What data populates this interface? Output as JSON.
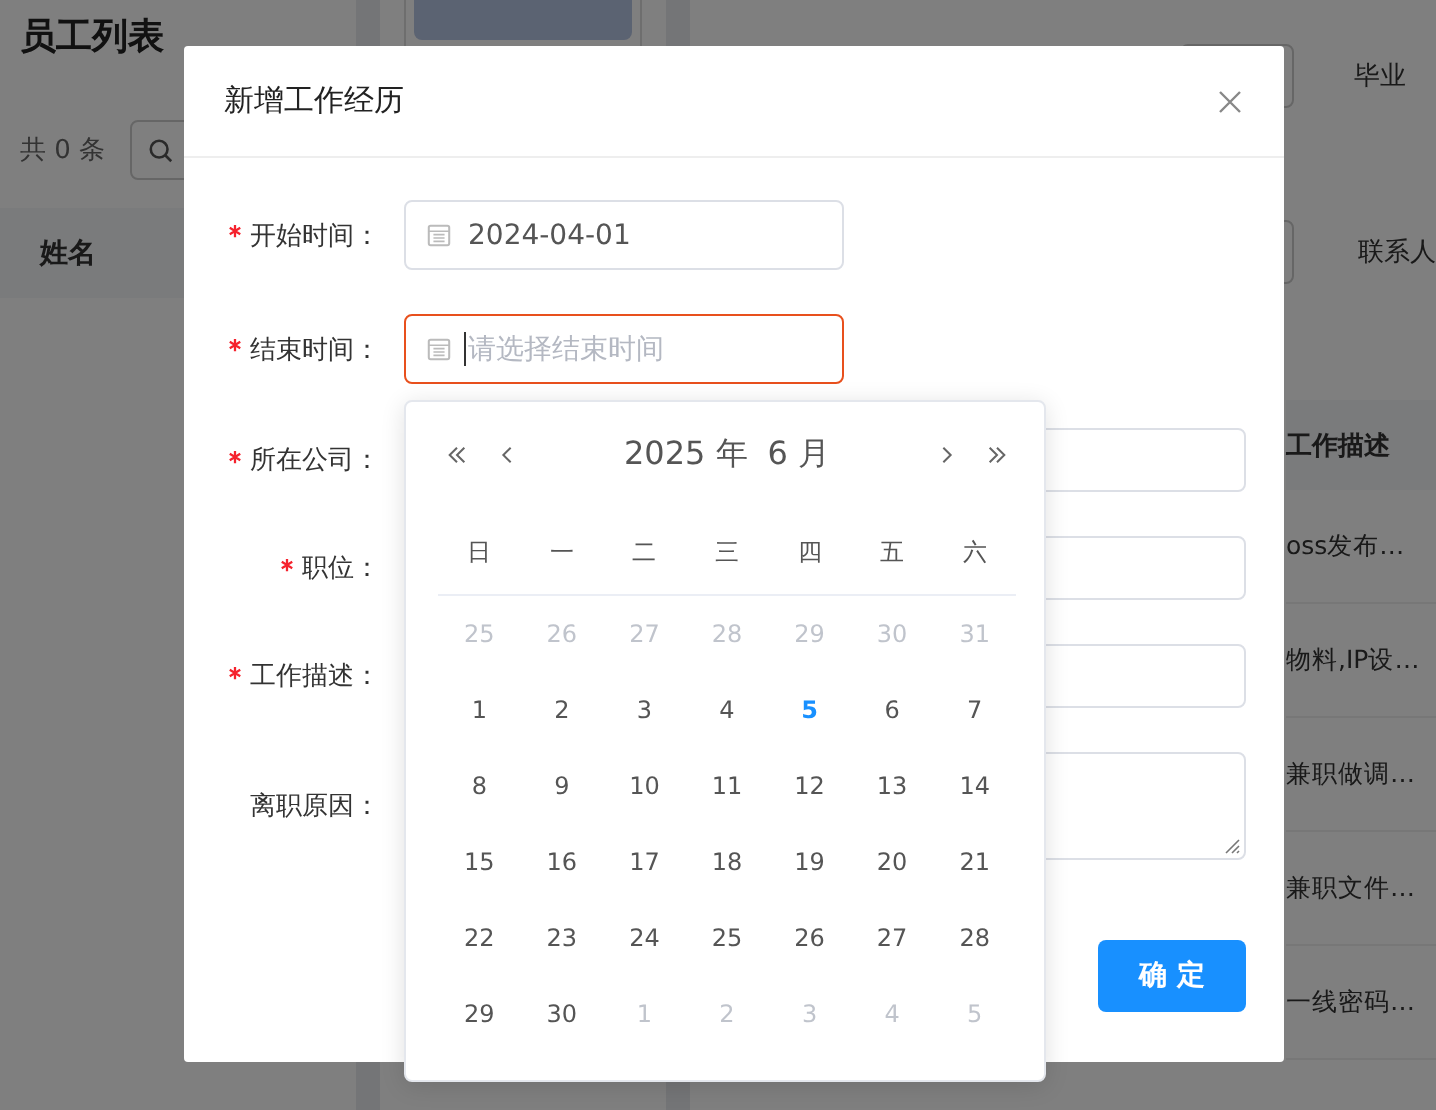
{
  "background": {
    "title": "员工列表",
    "count": "共 0 条",
    "name_header": "姓名",
    "labels": [
      "毕业",
      "联系人"
    ],
    "desc_header": "工作描述",
    "desc_rows": [
      "oss发布…",
      "物料,IP设…",
      "兼职做调…",
      "兼职文件…",
      "一线密码…"
    ]
  },
  "dialog": {
    "title": "新增工作经历",
    "fields": [
      {
        "label": "开始时间：",
        "required": true,
        "kind": "date",
        "value": "2024-04-01",
        "error": false
      },
      {
        "label": "结束时间：",
        "required": true,
        "kind": "date",
        "placeholder": "请选择结束时间",
        "error": true
      },
      {
        "label": "所在公司：",
        "required": true,
        "kind": "text",
        "error": false
      },
      {
        "label": "职位：",
        "required": true,
        "kind": "text",
        "error": false
      },
      {
        "label": "工作描述：",
        "required": true,
        "kind": "text",
        "error": false
      },
      {
        "label": "离职原因：",
        "required": false,
        "kind": "textarea",
        "error": false
      }
    ],
    "confirm": "确 定"
  },
  "date_picker": {
    "year": "2025 年",
    "month": "6 月",
    "weekdays": [
      "日",
      "一",
      "二",
      "三",
      "四",
      "五",
      "六"
    ],
    "weeks": [
      [
        {
          "d": "25",
          "kind": "other",
          "today": false
        },
        {
          "d": "26",
          "kind": "other",
          "today": false
        },
        {
          "d": "27",
          "kind": "other",
          "today": false
        },
        {
          "d": "28",
          "kind": "other",
          "today": false
        },
        {
          "d": "29",
          "kind": "other",
          "today": false
        },
        {
          "d": "30",
          "kind": "other",
          "today": false
        },
        {
          "d": "31",
          "kind": "other",
          "today": false
        }
      ],
      [
        {
          "d": "1",
          "kind": "current",
          "today": false
        },
        {
          "d": "2",
          "kind": "current",
          "today": false
        },
        {
          "d": "3",
          "kind": "current",
          "today": false
        },
        {
          "d": "4",
          "kind": "current",
          "today": false
        },
        {
          "d": "5",
          "kind": "current",
          "today": true
        },
        {
          "d": "6",
          "kind": "current",
          "today": false
        },
        {
          "d": "7",
          "kind": "current",
          "today": false
        }
      ],
      [
        {
          "d": "8",
          "kind": "current",
          "today": false
        },
        {
          "d": "9",
          "kind": "current",
          "today": false
        },
        {
          "d": "10",
          "kind": "current",
          "today": false
        },
        {
          "d": "11",
          "kind": "current",
          "today": false
        },
        {
          "d": "12",
          "kind": "current",
          "today": false
        },
        {
          "d": "13",
          "kind": "current",
          "today": false
        },
        {
          "d": "14",
          "kind": "current",
          "today": false
        }
      ],
      [
        {
          "d": "15",
          "kind": "current",
          "today": false
        },
        {
          "d": "16",
          "kind": "current",
          "today": false
        },
        {
          "d": "17",
          "kind": "current",
          "today": false
        },
        {
          "d": "18",
          "kind": "current",
          "today": false
        },
        {
          "d": "19",
          "kind": "current",
          "today": false
        },
        {
          "d": "20",
          "kind": "current",
          "today": false
        },
        {
          "d": "21",
          "kind": "current",
          "today": false
        }
      ],
      [
        {
          "d": "22",
          "kind": "current",
          "today": false
        },
        {
          "d": "23",
          "kind": "current",
          "today": false
        },
        {
          "d": "24",
          "kind": "current",
          "today": false
        },
        {
          "d": "25",
          "kind": "current",
          "today": false
        },
        {
          "d": "26",
          "kind": "current",
          "today": false
        },
        {
          "d": "27",
          "kind": "current",
          "today": false
        },
        {
          "d": "28",
          "kind": "current",
          "today": false
        }
      ],
      [
        {
          "d": "29",
          "kind": "current",
          "today": false
        },
        {
          "d": "30",
          "kind": "current",
          "today": false
        },
        {
          "d": "1",
          "kind": "other",
          "today": false
        },
        {
          "d": "2",
          "kind": "other",
          "today": false
        },
        {
          "d": "3",
          "kind": "other",
          "today": false
        },
        {
          "d": "4",
          "kind": "other",
          "today": false
        },
        {
          "d": "5",
          "kind": "other",
          "today": false
        }
      ]
    ]
  }
}
